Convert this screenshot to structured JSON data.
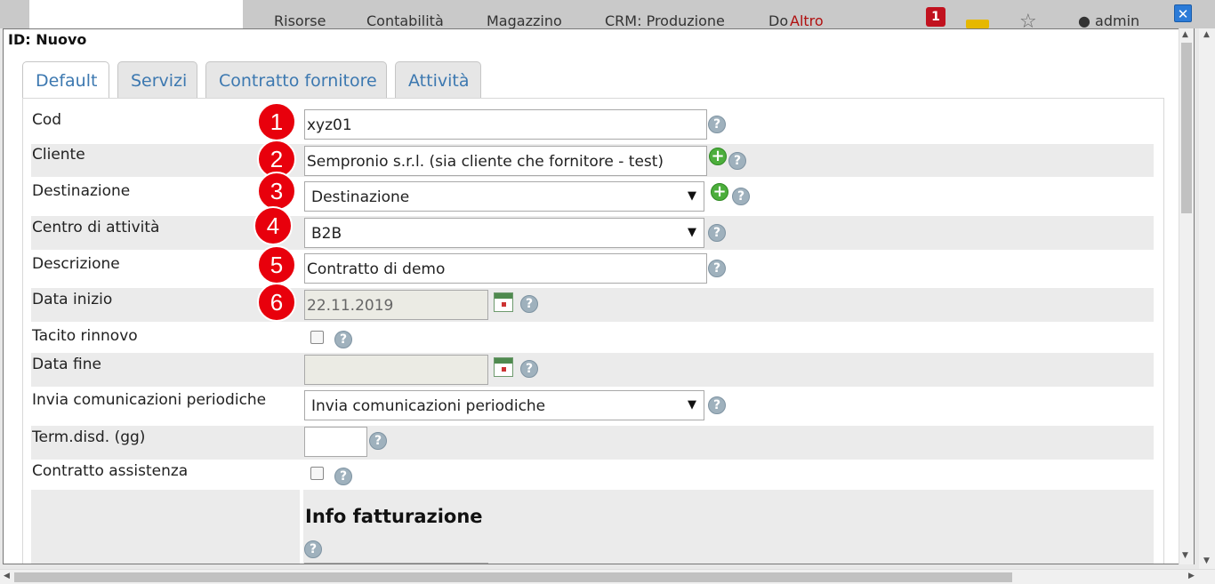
{
  "background_nav": {
    "items": [
      "Risorse",
      "Contabilità",
      "Magazzino",
      "CRM: Produzione",
      "Do"
    ],
    "overlap_text": "Altro",
    "notification_count": "1",
    "user": "admin"
  },
  "dialog": {
    "title": "ID: Nuovo",
    "tabs": [
      {
        "label": "Default",
        "active": true
      },
      {
        "label": "Servizi",
        "active": false
      },
      {
        "label": "Contratto fornitore",
        "active": false
      },
      {
        "label": "Attività",
        "active": false
      }
    ]
  },
  "form": {
    "cod": {
      "label": "Cod",
      "value": "xyz01"
    },
    "cliente": {
      "label": "Cliente",
      "value": "Sempronio s.r.l.   (sia cliente che fornitore - test)"
    },
    "destinazione": {
      "label": "Destinazione",
      "value": "Destinazione"
    },
    "centro": {
      "label": "Centro di attività",
      "value": "B2B"
    },
    "descrizione": {
      "label": "Descrizione",
      "value": "Contratto di demo"
    },
    "data_inizio": {
      "label": "Data inizio",
      "value": "22.11.2019"
    },
    "tacito": {
      "label": "Tacito rinnovo",
      "checked": false
    },
    "data_fine": {
      "label": "Data fine",
      "value": ""
    },
    "invia": {
      "label": "Invia comunicazioni periodiche",
      "value": "Invia comunicazioni periodiche"
    },
    "term": {
      "label": "Term.disd. (gg)",
      "value": ""
    },
    "assistenza": {
      "label": "Contratto assistenza",
      "checked": false
    },
    "info_fatturazione": {
      "title": "Info fatturazione"
    }
  },
  "markers": [
    "1",
    "2",
    "3",
    "4",
    "5",
    "6"
  ],
  "icons": {
    "help": "?",
    "plus": "+",
    "close": "✕",
    "dropdown": "▼"
  },
  "colors": {
    "tab_text": "#3c78b0",
    "marker": "#e8000c",
    "row_shade": "#ebebeb"
  }
}
